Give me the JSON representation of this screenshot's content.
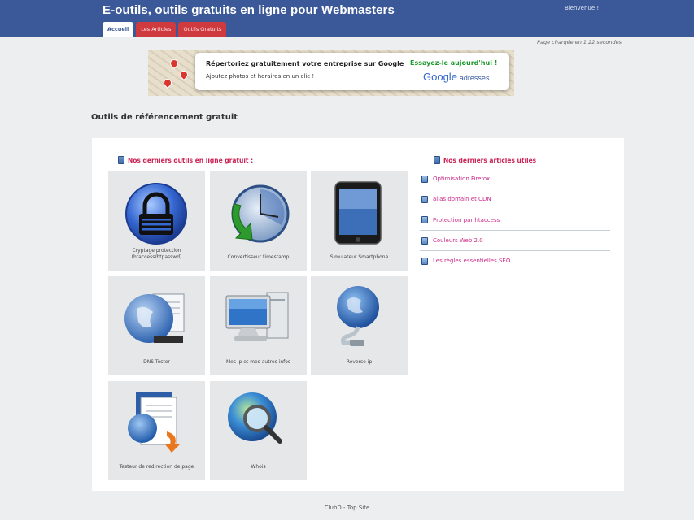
{
  "header": {
    "site_title": "E-outils, outils gratuits en ligne pour Webmasters",
    "top_link": "Bienvenue !",
    "brand_color": "#3b5998"
  },
  "tabs": [
    {
      "label": "Accueil",
      "active": true
    },
    {
      "label": "Les Articles",
      "active": false
    },
    {
      "label": "Outils Gratuits",
      "active": false
    }
  ],
  "generation_time": "Page chargée en 1.22 secondes",
  "ad": {
    "line1": "Répertoriez gratuitement votre entreprise sur Google",
    "line2": "Ajoutez photos et horaires en un clic !",
    "cta": "Essayez-le aujourd'hui !",
    "logo_word": "Google",
    "logo_suffix": "adresses"
  },
  "page_heading": "Outils de référencement gratuit",
  "tools_section": {
    "heading": "Nos derniers outils en ligne gratuit :",
    "tiles": [
      {
        "caption": "Cryptage protection (htaccess/htpasswd)",
        "icon": "lock-icon"
      },
      {
        "caption": "Convertisseur timestamp",
        "icon": "clock-icon"
      },
      {
        "caption": "Simulateur Smartphone",
        "icon": "smartphone-icon"
      },
      {
        "caption": "DNS Tester",
        "icon": "globe-document-icon"
      },
      {
        "caption": "Mes ip et mes autres infos",
        "icon": "computer-icon"
      },
      {
        "caption": "Reverse ip",
        "icon": "network-globe-icon"
      },
      {
        "caption": "Testeur de redirection de page",
        "icon": "redirect-document-icon"
      },
      {
        "caption": "Whois",
        "icon": "magnifier-globe-icon"
      }
    ]
  },
  "articles_section": {
    "heading": "Nos derniers articles utiles",
    "items": [
      {
        "label": "Optimisation Firefox"
      },
      {
        "label": "alias domain et CDN"
      },
      {
        "label": "Protection par htaccess"
      },
      {
        "label": "Couleurs Web 2.0"
      },
      {
        "label": "Les règles essentielles SEO"
      }
    ]
  },
  "footer": {
    "text": "ClubD - Top Site"
  }
}
